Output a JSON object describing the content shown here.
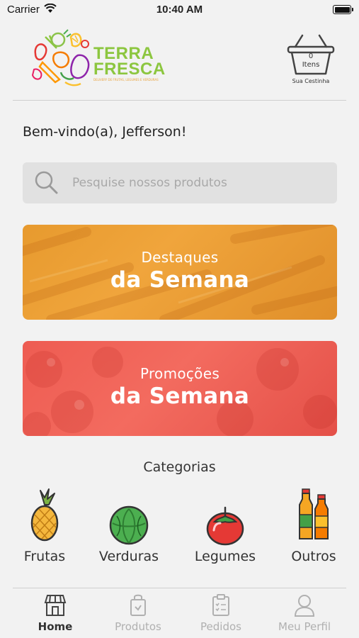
{
  "status_bar": {
    "carrier": "Carrier",
    "time": "10:40 AM"
  },
  "header": {
    "logo_line1": "TERRA",
    "logo_line2": "FRESCA",
    "logo_tagline": "DELIVERY DE FRUTAS, LEGUMES E VERDURAS",
    "basket": {
      "count": "0",
      "count_label": "Itens",
      "label": "Sua Cestinha"
    }
  },
  "welcome": "Bem-vindo(a), Jefferson!",
  "search": {
    "placeholder": "Pesquise nossos produtos"
  },
  "banners": [
    {
      "line1": "Destaques",
      "line2": "da Semana",
      "color": "#e99b32"
    },
    {
      "line1": "Promoções",
      "line2": "da Semana",
      "color": "#f0605a"
    }
  ],
  "categories": {
    "title": "Categorias",
    "items": [
      {
        "label": "Frutas",
        "icon": "pineapple-icon"
      },
      {
        "label": "Verduras",
        "icon": "lettuce-icon"
      },
      {
        "label": "Legumes",
        "icon": "tomato-icon"
      },
      {
        "label": "Outros",
        "icon": "bottles-icon"
      }
    ]
  },
  "tabbar": {
    "items": [
      {
        "label": "Home",
        "icon": "store-icon",
        "active": true
      },
      {
        "label": "Produtos",
        "icon": "bag-icon",
        "active": false
      },
      {
        "label": "Pedidos",
        "icon": "clipboard-icon",
        "active": false
      },
      {
        "label": "Meu Perfil",
        "icon": "user-icon",
        "active": false
      }
    ]
  },
  "colors": {
    "brand_green": "#8cc63f",
    "orange_banner": "#e99b32",
    "red_banner": "#f0605a"
  }
}
